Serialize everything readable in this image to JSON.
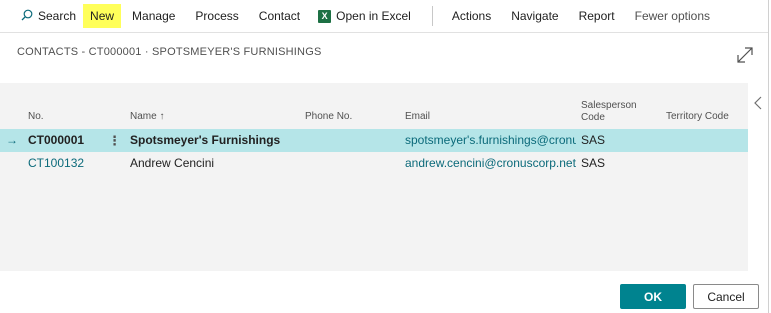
{
  "toolbar": {
    "search_label": "Search",
    "new_label": "New",
    "manage_label": "Manage",
    "process_label": "Process",
    "contact_label": "Contact",
    "excel_label": "Open in Excel",
    "excel_icon_letter": "X",
    "actions_label": "Actions",
    "navigate_label": "Navigate",
    "report_label": "Report",
    "fewer_label": "Fewer options"
  },
  "page": {
    "title": "CONTACTS - CT000001 · SPOTSMEYER'S FURNISHINGS"
  },
  "grid": {
    "headers": {
      "no": "No.",
      "name": "Name",
      "name_sort": "↑",
      "phone": "Phone No.",
      "email": "Email",
      "salesperson_line1": "Salesperson",
      "salesperson_line2": "Code",
      "territory": "Territory Code"
    },
    "rows": [
      {
        "no": "CT000001",
        "name": "Spotsmeyer's Furnishings",
        "phone": "",
        "email": "spotsmeyer's.furnishings@cronu...",
        "salesperson": "SAS",
        "territory": "",
        "arrow": "→",
        "menu": "⋮"
      },
      {
        "no": "CT100132",
        "name": "Andrew Cencini",
        "phone": "",
        "email": "andrew.cencini@cronuscorp.net",
        "salesperson": "SAS",
        "territory": ""
      }
    ]
  },
  "buttons": {
    "ok": "OK",
    "cancel": "Cancel"
  },
  "colors": {
    "accent": "#00838f",
    "selected_row": "#b5e5e8",
    "highlight": "#ffff5a",
    "link": "#0b6a7a"
  }
}
